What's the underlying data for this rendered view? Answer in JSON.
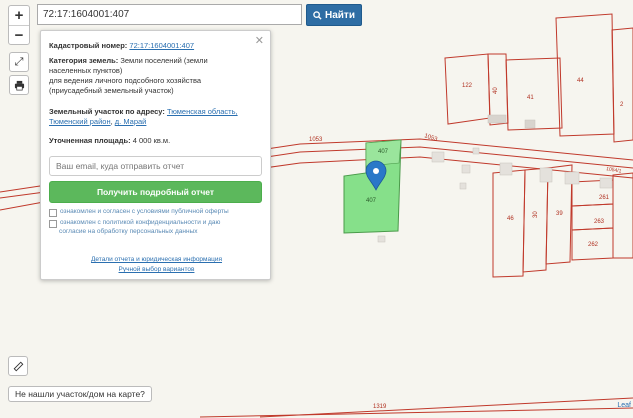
{
  "search": {
    "value": "72:17:1604001:407",
    "button_label": "Найти"
  },
  "zoom": {
    "in": "+",
    "out": "−"
  },
  "panel": {
    "cadastral_label": "Кадастровый номер:",
    "cadastral_value": "72:17:1604001:407",
    "category_label": "Категория земель:",
    "category_value": "Земли поселений (земли",
    "category_value_2": "населенных пунктов)",
    "usage_line_1": "для ведения личного подсобного хозяйства",
    "usage_line_2": "(приусадебный земельный участок)",
    "address_label": "Земельный участок по адресу:",
    "address_region": "Тюменская область,",
    "address_district": "Тюменский район",
    "address_comma": ",",
    "address_village": "д. Марай",
    "area_label": "Уточненная площадь:",
    "area_value": "4 000 кв.м.",
    "email_placeholder": "Ваш email, куда отправить отчет",
    "get_report_label": "Получить подробный отчет",
    "consent_offer": "ознакомлен и согласен с условиями публичной оферты",
    "consent_privacy_1": "ознакомлен с политикой конфиденциальности и даю",
    "consent_privacy_2": "согласие на обработку персональных данных",
    "report_details_link": "Детали отчета и юридическая информация",
    "manual_select_link": "Ручной выбор вариантов"
  },
  "not_found_label": "Не нашли участок/дом на карте?",
  "attribution": "Leaf",
  "map_labels": {
    "road_1053_a": "1053",
    "road_1053_b": "1053",
    "parcel_407_top": "407",
    "parcel_407_main": "407",
    "p122": "122",
    "p40": "40",
    "p41": "41",
    "p44": "44",
    "p2": "2",
    "p46": "46",
    "p30": "30",
    "p39": "39",
    "p261": "261",
    "p263": "263",
    "p262": "262",
    "p1319": "1319",
    "road_right": "1054/1"
  },
  "colors": {
    "parcel_outline": "#c0392b",
    "selected_fill": "#86e08a",
    "marker": "#2a78c8",
    "button_blue": "#2e6da4",
    "button_green": "#5cb85c"
  }
}
